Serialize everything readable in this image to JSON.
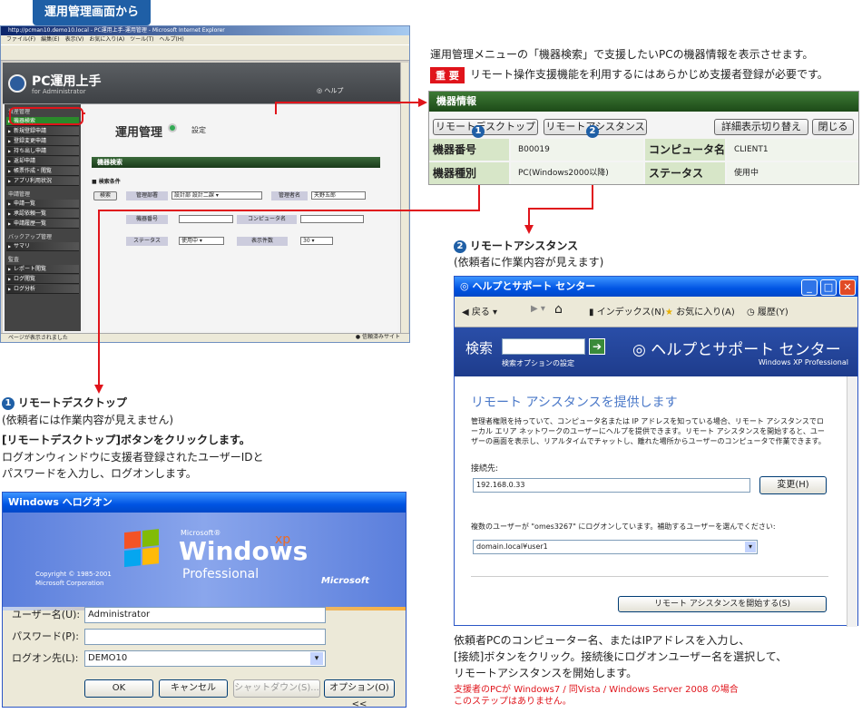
{
  "header_tag": "運用管理画面から",
  "ie": {
    "title": "http://pcman10.demo10.local - PC運用上手-運用管理 - Microsoft Internet Explorer",
    "menu": "ファイル(F)　編集(E)　表示(V)　お気に入り(A)　ツール(T)　ヘルプ(H)",
    "status": "ページが表示されました",
    "status_right": "信頼済みサイト",
    "brand": "PC運用上手",
    "brand_sub": "for Administrator",
    "help": "ヘルプ",
    "main_title": "運用管理",
    "settings": "設定",
    "section": "機器検索",
    "cond": "検索条件",
    "search_btn": "検索",
    "dept_label": "管理部署",
    "dept_value": "設計部 設計二課",
    "admin_label": "管理者名",
    "admin_value": "天野五郎",
    "num_label": "機器番号",
    "comp_label": "コンピュータ名",
    "status_label": "ステータス",
    "status_value": "使用中",
    "count_label": "表示件数",
    "count_value": "30",
    "side": [
      {
        "t": "cat",
        "l": "資産管理"
      },
      {
        "t": "sel",
        "l": "機器検索"
      },
      {
        "t": "it",
        "l": "新規登録申請"
      },
      {
        "t": "it",
        "l": "登録変更申請"
      },
      {
        "t": "it",
        "l": "持ち出し申請"
      },
      {
        "t": "it",
        "l": "返却申請"
      },
      {
        "t": "it",
        "l": "帳票作成・閲覧"
      },
      {
        "t": "it",
        "l": "アプリ利用状況"
      },
      {
        "t": "cat",
        "l": "申請管理"
      },
      {
        "t": "it",
        "l": "申請一覧"
      },
      {
        "t": "it",
        "l": "承認依頼一覧"
      },
      {
        "t": "it",
        "l": "申請履歴一覧"
      },
      {
        "t": "cat",
        "l": "バックアップ管理"
      },
      {
        "t": "it",
        "l": "サマリ"
      },
      {
        "t": "cat",
        "l": "監査"
      },
      {
        "t": "it",
        "l": "レポート閲覧"
      },
      {
        "t": "it",
        "l": "ログ閲覧"
      },
      {
        "t": "it",
        "l": "ログ分析"
      }
    ]
  },
  "intro": "運用管理メニューの「機器検索」で支援したいPCの機器情報を表示させます。",
  "important_badge": "重 要",
  "important_text": "リモート操作支援機能を利用するにはあらかじめ支援者登録が必要です。",
  "kiki": {
    "title": "機器情報",
    "rd_btn": "リモートデスクトップ",
    "ra_btn": "リモートアシスタンス",
    "detail_btn": "詳細表示切り替え",
    "close_btn": "閉じる",
    "num_label": "機器番号",
    "num_value": "B00019",
    "comp_label": "コンピュータ名",
    "comp_value": "CLIENT1",
    "type_label": "機器種別",
    "type_value": "PC(Windows2000以降)",
    "status_label": "ステータス",
    "status_value": "使用中"
  },
  "step1": {
    "num": "1",
    "title": "リモートデスクトップ",
    "sub": "(依頼者には作業内容が見えません)",
    "bold": "[リモートデスクトップ]ボタンをクリックします。",
    "desc1": "ログオンウィンドウに支援者登録されたユーザーIDと",
    "desc2": "パスワードを入力し、ログオンします。"
  },
  "step2": {
    "num": "2",
    "title": "リモートアシスタンス",
    "sub": "(依頼者に作業内容が見えます)",
    "desc1": "依頼者PCのコンピューター名、またはIPアドレスを入力し、",
    "desc2": "[接続]ボタンをクリック。接続後にログオンユーザー名を選択して、",
    "desc3": "リモートアシスタンスを開始します。",
    "note1": "支援者のPCが Windows7 / 同Vista / Windows Server 2008 の場合",
    "note2": "このステップはありません。"
  },
  "logon": {
    "title": "Windows へログオン",
    "copyright1": "Copyright © 1985-2001",
    "copyright2": "Microsoft Corporation",
    "ms": "Microsoft",
    "logo_ms": "Microsoft®",
    "logo_win": "Windows",
    "logo_xp": "xp",
    "logo_pro": "Professional",
    "user_label": "ユーザー名(U):",
    "user_value": "Administrator",
    "pass_label": "パスワード(P):",
    "dest_label": "ログオン先(L):",
    "dest_value": "DEMO10",
    "ok": "OK",
    "cancel": "キャンセル",
    "shutdown": "シャットダウン(S)...",
    "options": "オプション(O) <<"
  },
  "hs": {
    "title": "ヘルプとサポート センター",
    "back": "戻る",
    "index": "インデックス(N)",
    "fav": "お気に入り(A)",
    "hist": "履歴(Y)",
    "search_label": "検索",
    "search_opt": "検索オプションの設定",
    "brand": "ヘルプとサポート センター",
    "brand_sub": "Windows XP Professional",
    "heading": "リモート アシスタンスを提供します",
    "body": "管理者権限を持っていて、コンピュータ名または IP アドレスを知っている場合、リモート アシスタンスでローカル エリア ネットワークのユーザーにヘルプを提供できます。リモート アシスタンスを開始すると、ユーザーの画面を表示し、リアルタイムでチャットし、離れた場所からユーザーのコンピュータで作業できます。",
    "conn_label": "接続先:",
    "conn_value": "192.168.0.33",
    "change_btn": "変更(H)",
    "users_label": "複数のユーザーが \"omes3267\" にログオンしています。補助するユーザーを選んでください:",
    "user_value": "domain.local¥user1",
    "start_btn": "リモート アシスタンスを開始する(S)"
  }
}
